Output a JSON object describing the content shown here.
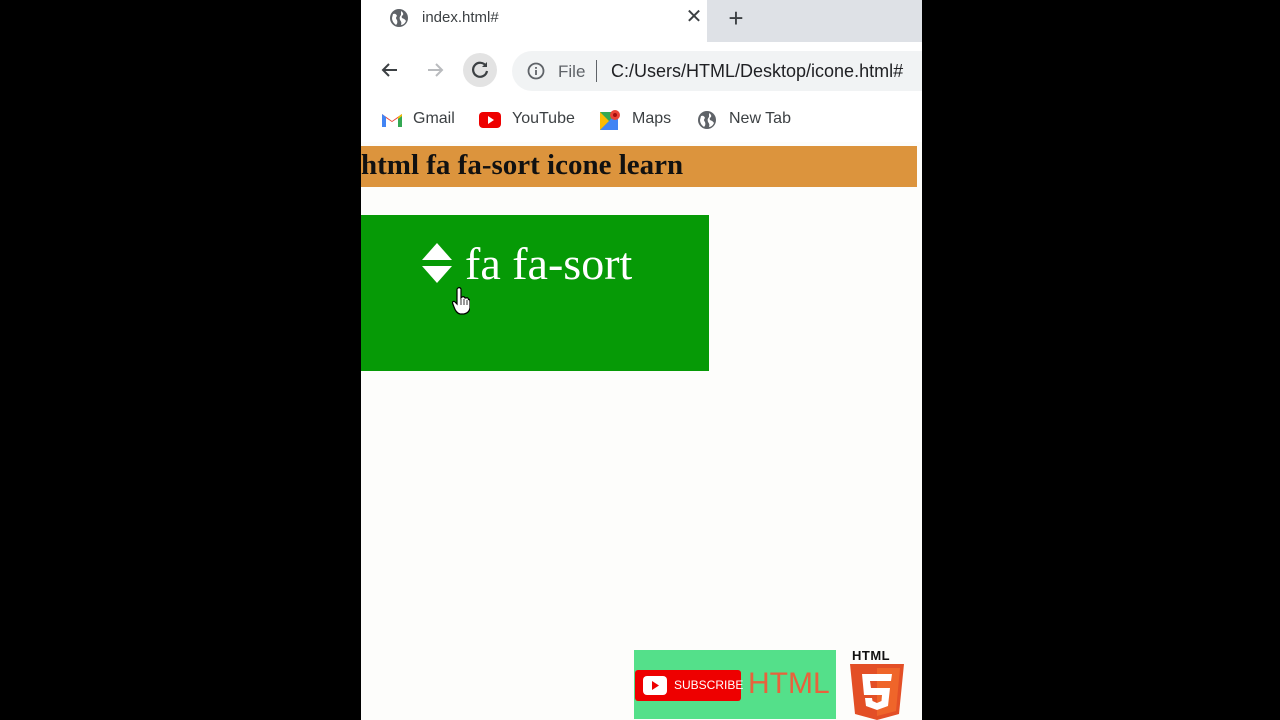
{
  "tab": {
    "title": "index.html#",
    "close_glyph": "✕",
    "new_tab_glyph": "+"
  },
  "toolbar": {
    "file_label": "File",
    "url": "C:/Users/HTML/Desktop/icone.html#"
  },
  "bookmarks": [
    {
      "label": "Gmail",
      "icon": "gmail-icon"
    },
    {
      "label": "YouTube",
      "icon": "youtube-icon"
    },
    {
      "label": "Maps",
      "icon": "maps-icon"
    },
    {
      "label": "New Tab",
      "icon": "globe-icon"
    }
  ],
  "page": {
    "heading": "html fa fa-sort icone learn",
    "box_label": "fa fa-sort",
    "heading_bg": "#dc943d",
    "box_bg": "#069a06"
  },
  "overlay": {
    "subscribe": "SUBSCRIBE",
    "html_text": "HTML",
    "badge_word": "HTML"
  }
}
